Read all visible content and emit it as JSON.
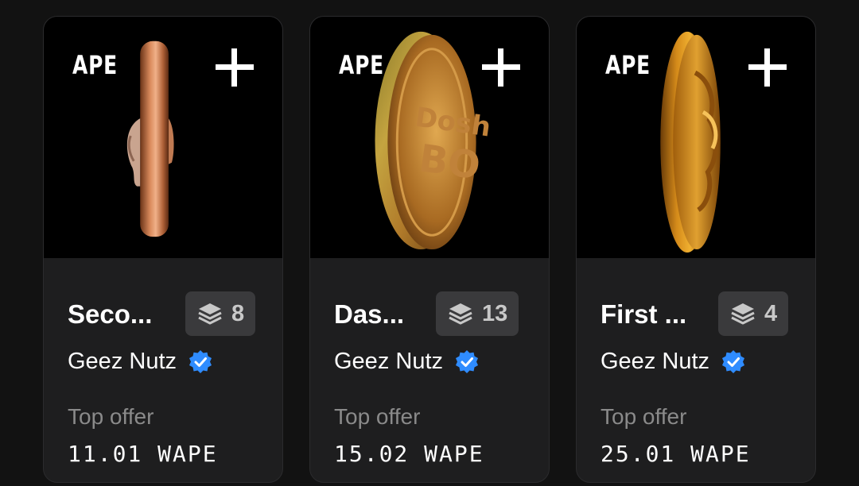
{
  "cards": [
    {
      "brand": "APE",
      "title": "Seco...",
      "count": "8",
      "collection": "Geez Nutz",
      "offer_label": "Top offer",
      "price": "11.01 WAPE"
    },
    {
      "brand": "APE",
      "title": "Das...",
      "count": "13",
      "collection": "Geez Nutz",
      "offer_label": "Top offer",
      "price": "15.02 WAPE"
    },
    {
      "brand": "APE",
      "title": "First ...",
      "count": "4",
      "collection": "Geez Nutz",
      "offer_label": "Top offer",
      "price": "25.01 WAPE"
    }
  ],
  "colors": {
    "background": "#121212",
    "card": "#1e1e1f",
    "badge": "#3a3a3c",
    "verified": "#2f8cff",
    "muted": "#8a8a8a"
  },
  "icons": {
    "add": "plus-icon",
    "editions": "layers-icon",
    "verified": "verified-badge-icon"
  }
}
